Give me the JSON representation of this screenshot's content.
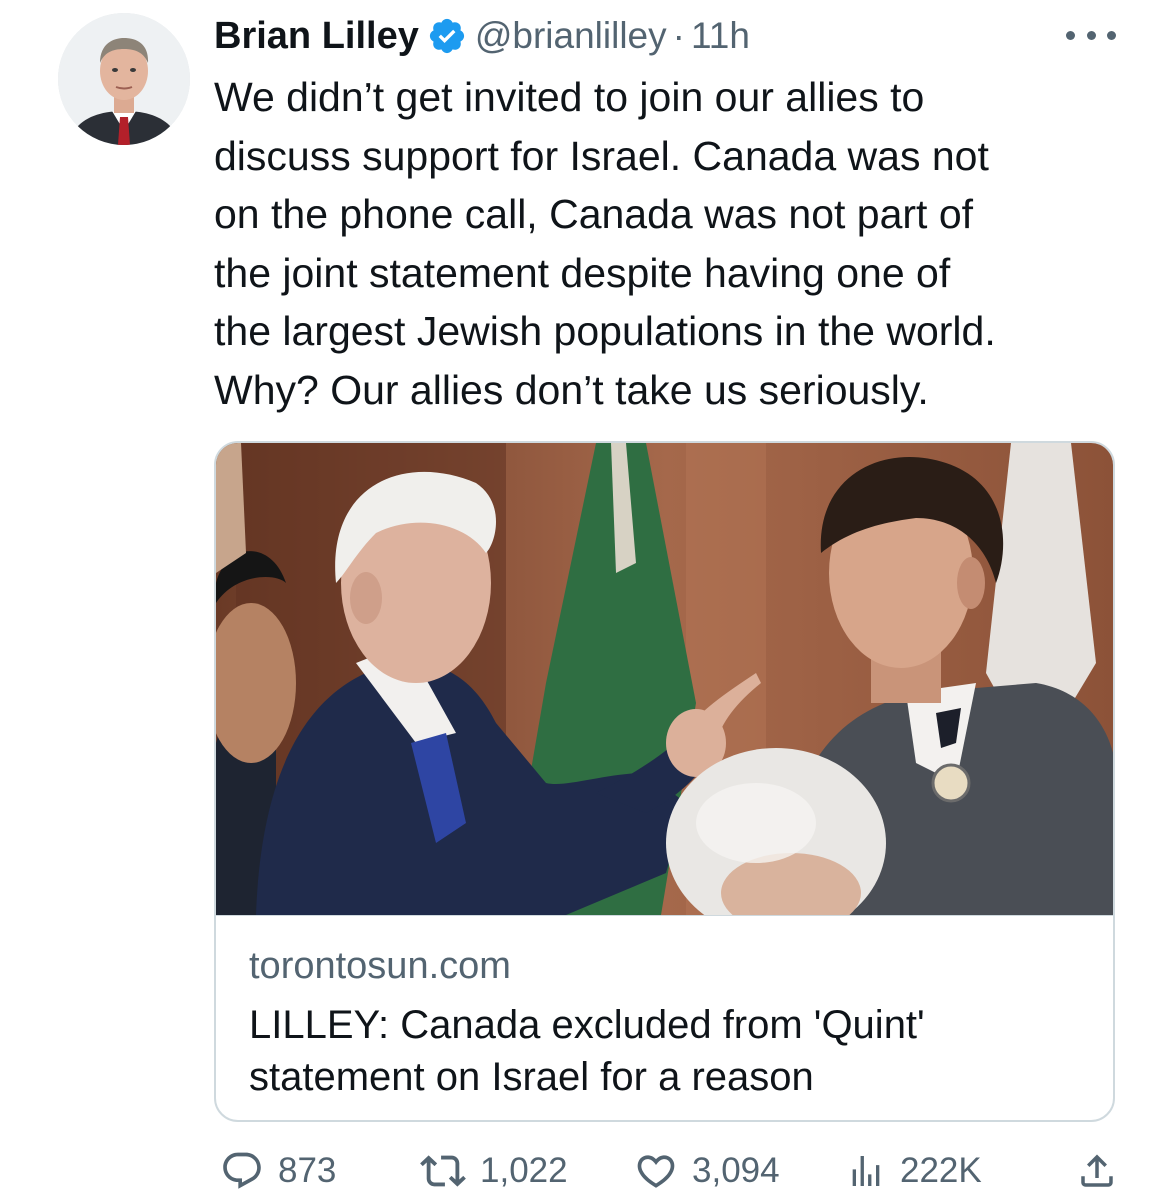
{
  "author": {
    "display_name": "Brian Lilley",
    "handle": "@brianlilley",
    "separator": "·",
    "time": "11h",
    "verified": true
  },
  "tweet": {
    "text_lines": [
      "We didn’t get invited to join our allies to",
      "discuss support for Israel. Canada was not",
      "on the phone call, Canada was not part of",
      "the joint statement despite having one of",
      "the largest Jewish populations in the world.",
      "Why? Our allies don’t take us seriously."
    ]
  },
  "card": {
    "domain": "torontosun.com",
    "title_lines": [
      "LILLEY: Canada excluded from 'Quint'",
      "statement on Israel for a reason"
    ]
  },
  "actions": {
    "replies": "873",
    "retweets": "1,022",
    "likes": "3,094",
    "views": "222K"
  },
  "icons": {
    "verified": "verified-badge-icon",
    "more": "more-options-icon",
    "reply": "reply-icon",
    "retweet": "retweet-icon",
    "like": "heart-icon",
    "views": "views-chart-icon",
    "share": "share-icon"
  },
  "colors": {
    "text_primary": "#0f1419",
    "text_secondary": "#536471",
    "verified_blue": "#1d9bf0",
    "border": "#cfd9de"
  }
}
